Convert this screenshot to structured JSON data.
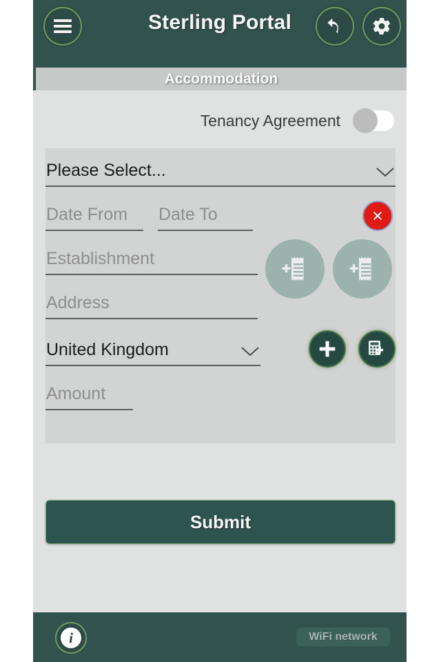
{
  "header": {
    "title": "Sterling Portal",
    "menu_icon": "hamburger-menu-icon",
    "undo_icon": "undo-arrow-icon",
    "settings_icon": "gear-icon"
  },
  "tab": {
    "label": "Accommodation"
  },
  "form": {
    "toggle": {
      "label": "Tenancy Agreement",
      "state": "off"
    },
    "type_select": {
      "value": "Please Select...",
      "chevron_icon": "chevron-down-icon"
    },
    "date_from": {
      "placeholder": "Date From",
      "value": ""
    },
    "date_to": {
      "placeholder": "Date To",
      "value": ""
    },
    "establishment": {
      "placeholder": "Establishment",
      "value": ""
    },
    "address": {
      "placeholder": "Address",
      "value": ""
    },
    "country_select": {
      "value": "United Kingdom",
      "chevron_icon": "chevron-down-icon"
    },
    "amount": {
      "placeholder": "Amount",
      "value": ""
    },
    "delete_icon": "delete-circle-x-icon",
    "receipt_button_1_icon": "add-receipt-icon",
    "receipt_button_2_icon": "add-receipt-icon",
    "add_icon": "plus-icon",
    "calculator_icon": "add-calculator-icon"
  },
  "actions": {
    "submit_label": "Submit"
  },
  "footer": {
    "info_icon": "info-icon",
    "info_glyph": "i",
    "network_label": "WiFi network"
  },
  "colors": {
    "brand_dark": "#32524e",
    "brand_border": "#6f9a63",
    "page_bg": "#e0e1e1",
    "panel_bg": "#d2d3d3",
    "tab_bg": "#c7c8c8",
    "danger": "#e01b15",
    "receipt_disabled": "#9bb2ad"
  }
}
